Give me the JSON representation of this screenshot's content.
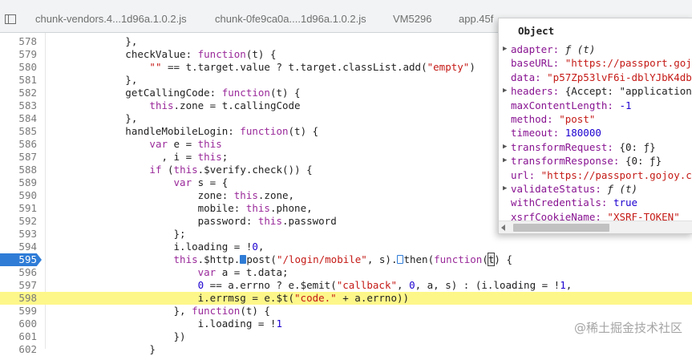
{
  "tabs": [
    {
      "label": "chunk-vendors.4...1d96a.1.0.2.js"
    },
    {
      "label": "chunk-0fe9ca0a....1d96a.1.0.2.js"
    },
    {
      "label": "VM5296"
    },
    {
      "label": "app.45f"
    }
  ],
  "code": {
    "breakpoint_line": "595",
    "highlight_line": "598",
    "lines": [
      {
        "n": "578",
        "t": "            },"
      },
      {
        "n": "579",
        "t": "            checkValue: function(t) {"
      },
      {
        "n": "580",
        "t": "                \"\" == t.target.value ? t.target.classList.add(\"empty\")"
      },
      {
        "n": "581",
        "t": "            },"
      },
      {
        "n": "582",
        "t": "            getCallingCode: function(t) {"
      },
      {
        "n": "583",
        "t": "                this.zone = t.callingCode"
      },
      {
        "n": "584",
        "t": "            },"
      },
      {
        "n": "585",
        "t": "            handleMobileLogin: function(t) {"
      },
      {
        "n": "586",
        "t": "                var e = this"
      },
      {
        "n": "587",
        "t": "                  , i = this;"
      },
      {
        "n": "588",
        "t": "                if (this.$verify.check()) {"
      },
      {
        "n": "589",
        "t": "                    var s = {"
      },
      {
        "n": "590",
        "t": "                        zone: this.zone,"
      },
      {
        "n": "591",
        "t": "                        mobile: this.phone,"
      },
      {
        "n": "592",
        "t": "                        password: this.password"
      },
      {
        "n": "593",
        "t": "                    };"
      },
      {
        "n": "594",
        "t": "                    i.loading = !0,"
      },
      {
        "n": "595",
        "t": "                    this.$http.▶post(\"/login/mobile\", s).▷then(function(t) {"
      },
      {
        "n": "596",
        "t": "                        var a = t.data;"
      },
      {
        "n": "597",
        "t": "                        0 == a.errno ? e.$emit(\"callback\", 0, a, s) : (i.loading = !1,"
      },
      {
        "n": "598",
        "t": "                        i.errmsg = e.$t(\"code.\" + a.errno))"
      },
      {
        "n": "599",
        "t": "                    }, function(t) {"
      },
      {
        "n": "600",
        "t": "                        i.loading = !1"
      },
      {
        "n": "601",
        "t": "                    })"
      },
      {
        "n": "602",
        "t": "                }"
      }
    ]
  },
  "popup": {
    "title": "Object",
    "properties": [
      {
        "key": "adapter",
        "value": "ƒ (t)",
        "kind": "fn",
        "expandable": true
      },
      {
        "key": "baseURL",
        "value": "\"https://passport.gojo",
        "kind": "str",
        "expandable": false
      },
      {
        "key": "data",
        "value": "\"p57Zp53lvF6i-dblYJbK4db",
        "kind": "str",
        "expandable": false
      },
      {
        "key": "headers",
        "value": "{Accept: \"application/",
        "kind": "obj",
        "expandable": true
      },
      {
        "key": "maxContentLength",
        "value": "-1",
        "kind": "num",
        "expandable": false
      },
      {
        "key": "method",
        "value": "\"post\"",
        "kind": "str",
        "expandable": false
      },
      {
        "key": "timeout",
        "value": "180000",
        "kind": "num",
        "expandable": false
      },
      {
        "key": "transformRequest",
        "value": "{0: ƒ}",
        "kind": "obj",
        "expandable": true
      },
      {
        "key": "transformResponse",
        "value": "{0: ƒ}",
        "kind": "obj",
        "expandable": true
      },
      {
        "key": "url",
        "value": "\"https://passport.gojoy.co",
        "kind": "str",
        "expandable": false
      },
      {
        "key": "validateStatus",
        "value": "ƒ (t)",
        "kind": "fn",
        "expandable": true
      },
      {
        "key": "withCredentials",
        "value": "true",
        "kind": "num",
        "expandable": false
      },
      {
        "key": "xsrfCookieName",
        "value": "\"XSRF-TOKEN\"",
        "kind": "str",
        "expandable": false
      }
    ]
  },
  "watermark": "@稀土掘金技术社区",
  "icons": {
    "tab_toggle": "sidebar-toggle-icon",
    "breakpoint": "breakpoint-marker-icon",
    "scroll_left": "scroll-left-arrow-icon"
  },
  "colors": {
    "breakpoint": "#2f7cd6",
    "highlight": "#fdf78a",
    "keyword": "#9a2a9a",
    "string": "#c41a16",
    "number": "#1c00cf",
    "property_key": "#881391"
  }
}
